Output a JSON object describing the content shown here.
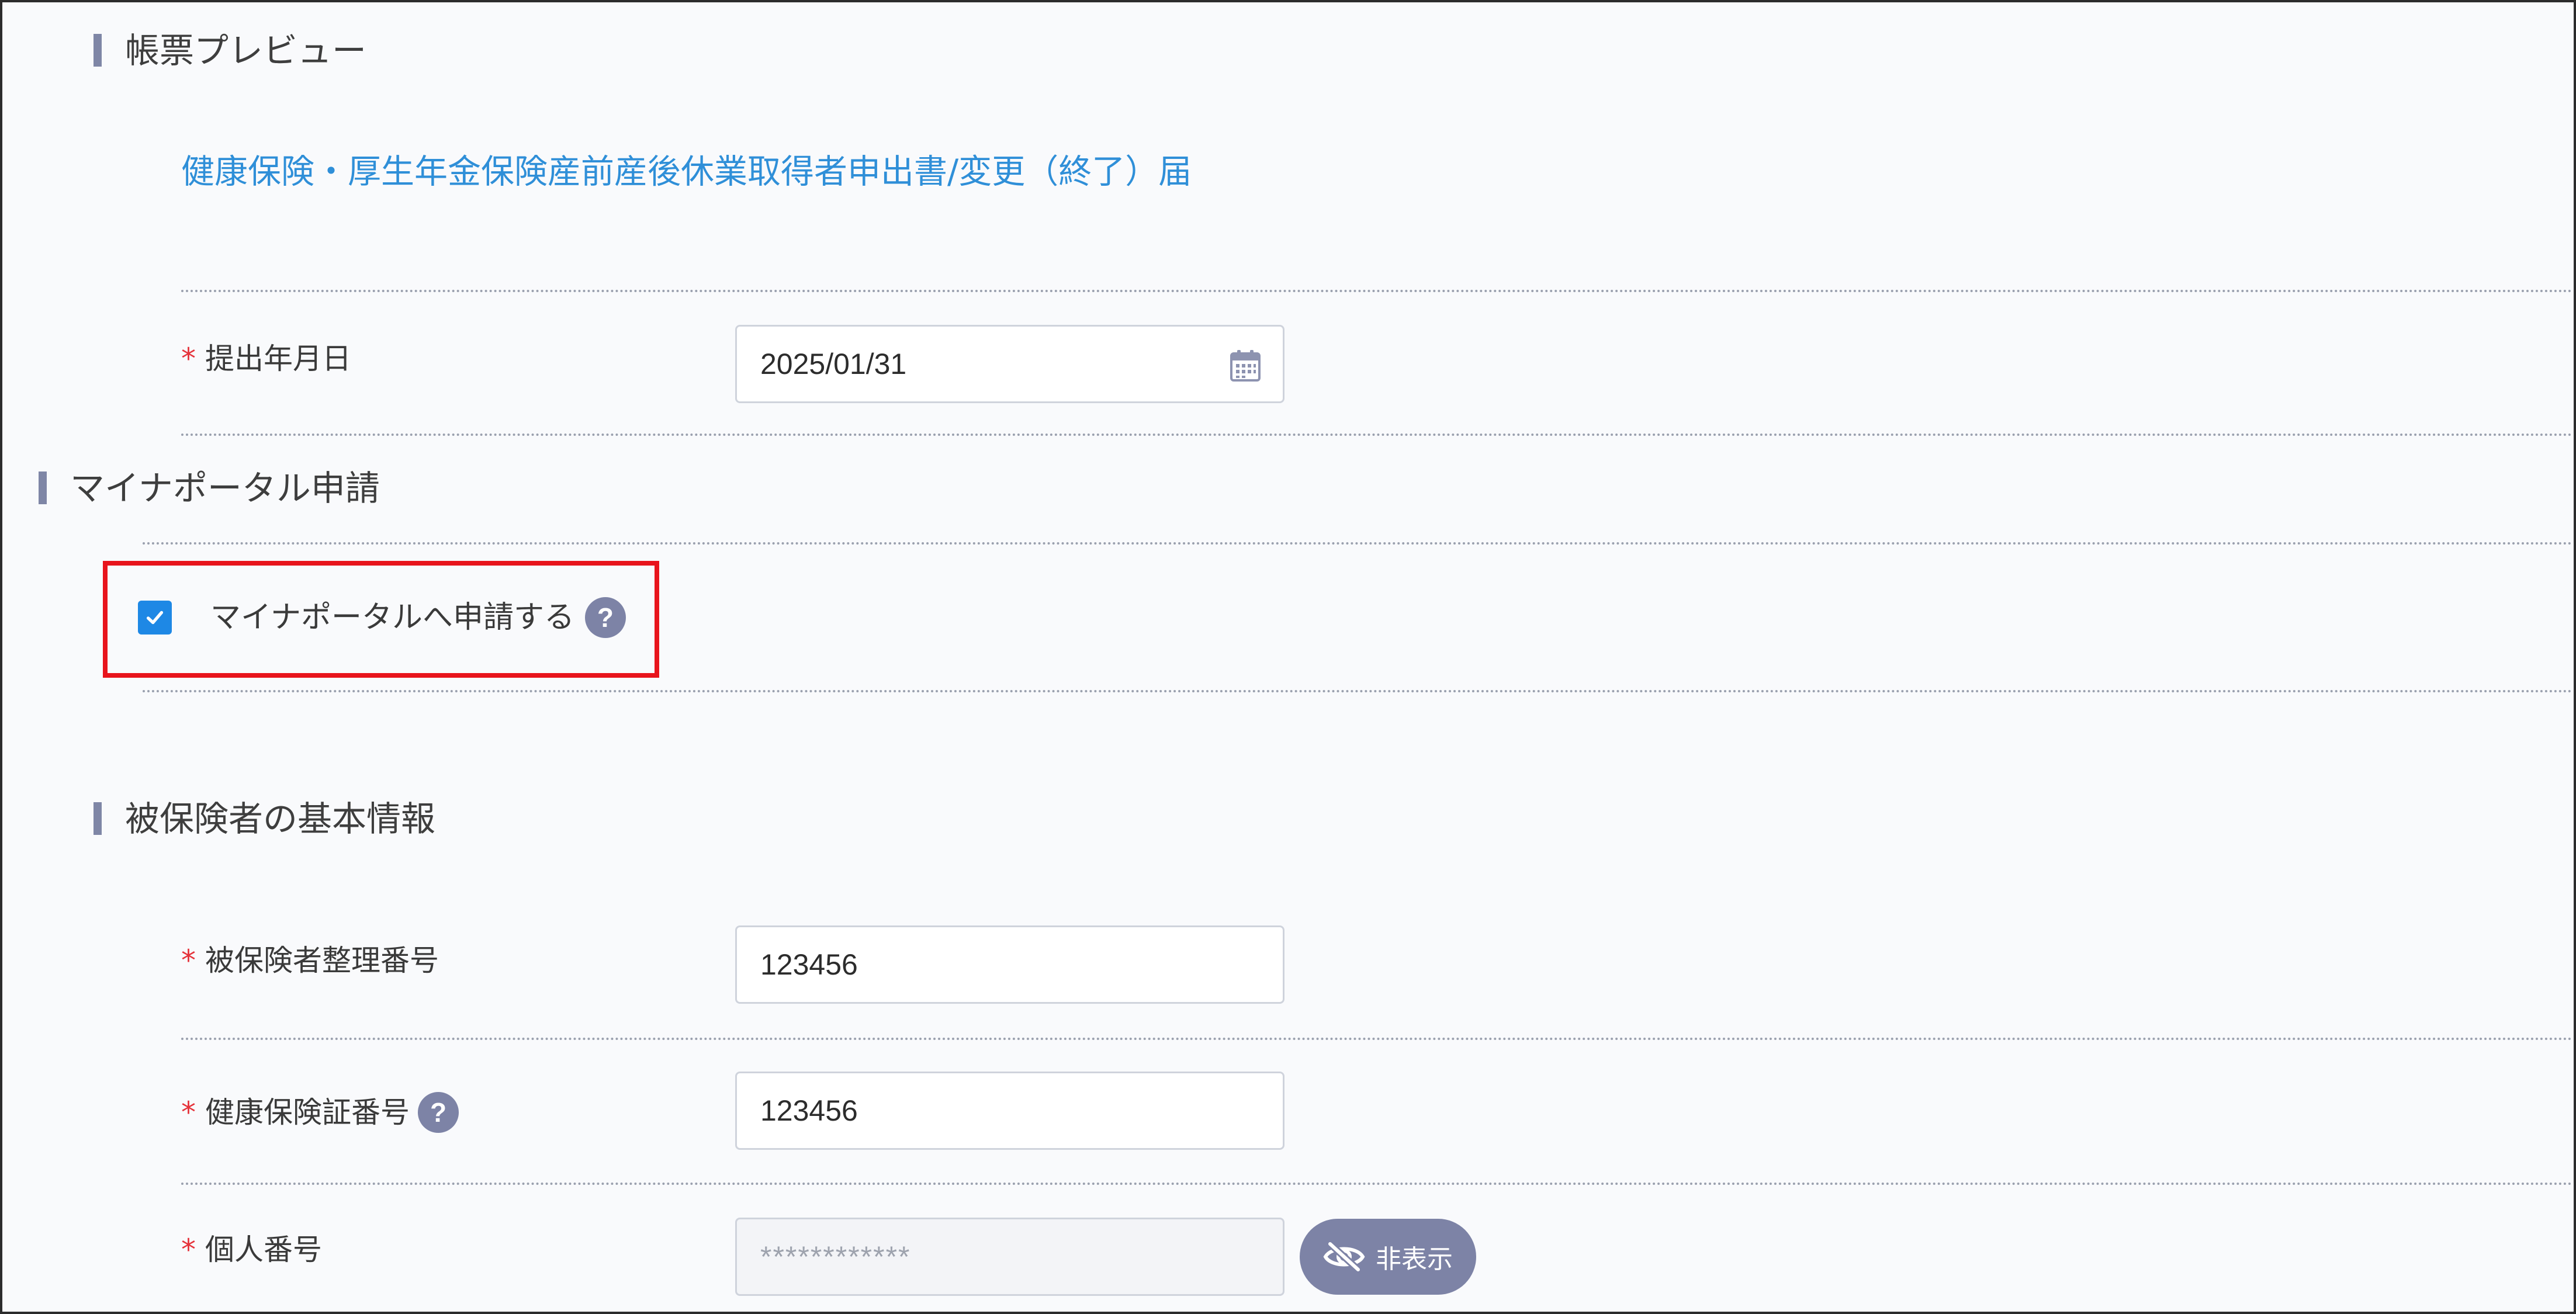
{
  "preview_section": {
    "title": "帳票プレビュー",
    "document_link": "健康保険・厚生年金保険産前産後休業取得者申出書/変更（終了）届"
  },
  "submission_date": {
    "required_mark": "*",
    "label": "提出年月日",
    "value": "2025/01/31",
    "icon": "calendar-icon"
  },
  "mynaportal_section": {
    "title": "マイナポータル申請",
    "checkbox_label": "マイナポータルへ申請する",
    "checkbox_checked": true,
    "help_icon_glyph": "?"
  },
  "insured_basic_section": {
    "title": "被保険者の基本情報",
    "fields": [
      {
        "required_mark": "*",
        "label": "被保険者整理番号",
        "value": "123456"
      },
      {
        "required_mark": "*",
        "label": "健康保険証番号",
        "value": "123456",
        "help_icon_glyph": "?"
      },
      {
        "required_mark": "*",
        "label": "個人番号",
        "value": "************",
        "toggle_button_label": "非表示",
        "toggle_icon": "eye-off-icon"
      }
    ]
  },
  "colors": {
    "accent_blue": "#2f8fd8",
    "checkbox_blue": "#1e88e5",
    "required_red": "#e5323a",
    "highlight_red": "#e8141c",
    "section_bar": "#7f86a6",
    "help_icon_bg": "#7d83a6",
    "page_bg": "#f9fafc"
  }
}
